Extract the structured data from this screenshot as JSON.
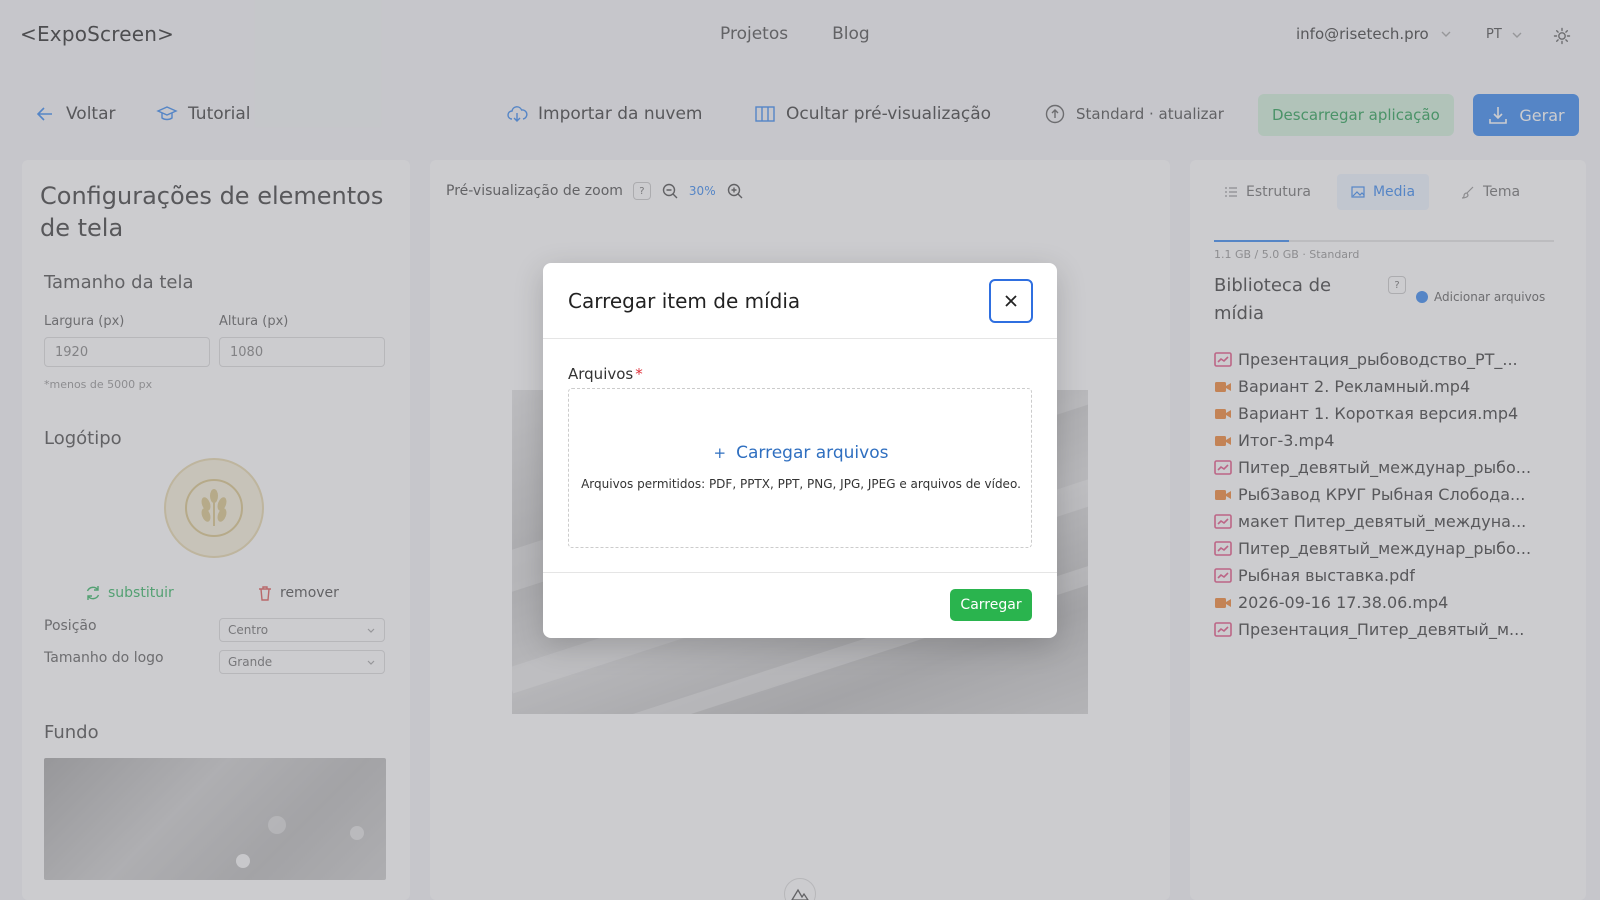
{
  "header": {
    "brand": "<ExpoScreen>",
    "nav": [
      "Projetos",
      "Blog"
    ],
    "account": "info@risetech.pro",
    "language": "PT"
  },
  "toolbar": {
    "back": "Voltar",
    "tutorial": "Tutorial",
    "import_cloud": "Importar da nuvem",
    "hide_preview": "Ocultar pré-visualização",
    "standard_update": "Standard · atualizar",
    "download_app": "Descarregar aplicação",
    "generate": "Gerar"
  },
  "left_panel": {
    "title": "Configurações de elementos de tela",
    "screen_size": {
      "title": "Tamanho da tela",
      "width_label": "Largura (px)",
      "height_label": "Altura (px)",
      "width_value": "1920",
      "height_value": "1080",
      "hint": "*menos de 5000 px"
    },
    "logo": {
      "title": "Logótipo",
      "replace": "substituir",
      "remove": "remover",
      "position_label": "Posição",
      "position_value": "Centro",
      "size_label": "Tamanho do logo",
      "size_value": "Grande"
    },
    "background": {
      "title": "Fundo"
    }
  },
  "center_panel": {
    "zoom_label": "Pré-visualização de zoom",
    "help": "?",
    "zoom_value": "30%"
  },
  "right_panel": {
    "tabs": [
      "Estrutura",
      "Media",
      "Tema"
    ],
    "active_tab": "Media",
    "storage_used_fraction": 0.22,
    "storage_text": "1.1 GB / 5.0 GB · Standard",
    "library_title": "Biblioteca de mídia",
    "help": "?",
    "add_files": "Adicionar arquivos",
    "files": [
      {
        "name": "Презентация_рыбоводство_РТ_...",
        "type": "pdf"
      },
      {
        "name": "Вариант 2. Рекламный.mp4",
        "type": "video"
      },
      {
        "name": "Вариант 1. Короткая версия.mp4",
        "type": "video"
      },
      {
        "name": "Итог-3.mp4",
        "type": "video"
      },
      {
        "name": "Питер_девятый_междунар_рыбо...",
        "type": "pdf"
      },
      {
        "name": "РыбЗавод КРУГ Рыбная Слобода...",
        "type": "video"
      },
      {
        "name": "макет Питер_девятый_междуна...",
        "type": "pdf"
      },
      {
        "name": "Питер_девятый_междунар_рыбо...",
        "type": "pdf"
      },
      {
        "name": "Рыбная выставка.pdf",
        "type": "pdf"
      },
      {
        "name": "2026-09-16 17.38.06.mp4",
        "type": "video"
      },
      {
        "name": "Презентация_Питер_девятый_м...",
        "type": "pdf"
      }
    ]
  },
  "modal": {
    "title": "Carregar item de mídia",
    "field_label": "Arquivos",
    "required_mark": "*",
    "upload_link": "Carregar arquivos",
    "allowed_hint": "Arquivos permitidos: PDF, PPTX, PPT, PNG, JPG, JPEG e arquivos de vídeo.",
    "submit": "Carregar"
  },
  "colors": {
    "accent": "#3f8df0",
    "success": "#2ab44e",
    "required": "#e0323c",
    "pdf_icon": "#e55a8a",
    "video_icon": "#f08a3c"
  }
}
